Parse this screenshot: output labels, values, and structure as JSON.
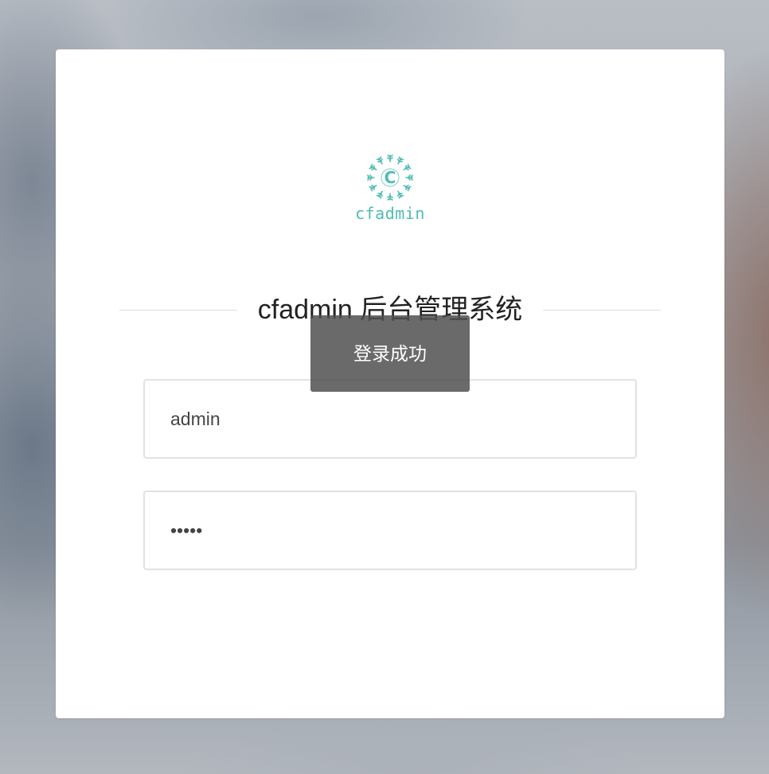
{
  "logo": {
    "emblem_letter": "C",
    "text": "cfadmin",
    "color": "#4fbcb4"
  },
  "login": {
    "title": "cfadmin 后台管理系统",
    "username": {
      "value": "admin"
    },
    "password": {
      "value": "•••••"
    }
  },
  "toast": {
    "message": "登录成功"
  }
}
